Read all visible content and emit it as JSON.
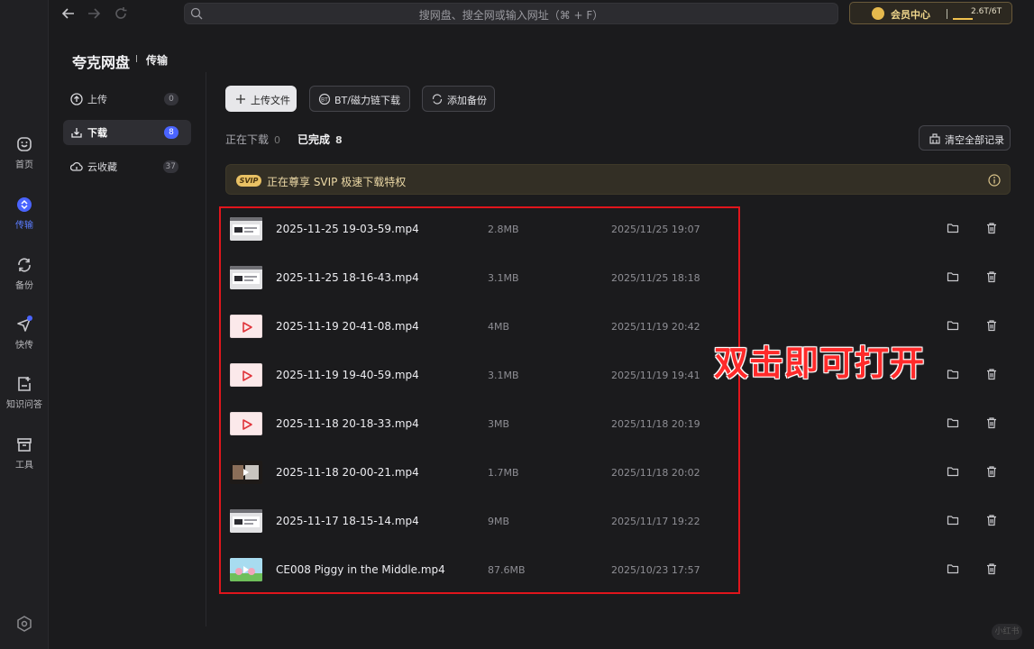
{
  "topbar": {
    "search_placeholder": "搜网盘、搜全网或输入网址（⌘ + F）",
    "vip_label": "会员中心",
    "storage_text": "2.6T/6T",
    "storage_used_fraction": 0.43
  },
  "rail": {
    "items": [
      {
        "label": "首页",
        "icon": "home-icon"
      },
      {
        "label": "传输",
        "icon": "transfer-icon"
      },
      {
        "label": "备份",
        "icon": "backup-icon"
      },
      {
        "label": "快传",
        "icon": "send-icon"
      },
      {
        "label": "知识问答",
        "icon": "qa-icon"
      },
      {
        "label": "工具",
        "icon": "toolbox-icon"
      }
    ]
  },
  "header": {
    "app_name": "夸克网盘",
    "section": "传输"
  },
  "sidebar": {
    "items": [
      {
        "label": "上传",
        "count": "0"
      },
      {
        "label": "下载",
        "count": "8"
      },
      {
        "label": "云收藏",
        "count": "37"
      }
    ]
  },
  "toolbar": {
    "upload_label": "上传文件",
    "bt_label": "BT/磁力链下载",
    "backup_label": "添加备份",
    "clear_label": "清空全部记录"
  },
  "tabs": [
    {
      "label": "正在下载",
      "count": "0"
    },
    {
      "label": "已完成",
      "count": "8"
    }
  ],
  "banner": {
    "badge": "SVIP",
    "text": "正在尊享 SVIP 极速下载特权"
  },
  "files": [
    {
      "name": "2025-11-25 19-03-59.mp4",
      "size": "2.8MB",
      "date": "2025/11/25 19:07",
      "thumb": "screen"
    },
    {
      "name": "2025-11-25 18-16-43.mp4",
      "size": "3.1MB",
      "date": "2025/11/25 18:18",
      "thumb": "screen"
    },
    {
      "name": "2025-11-19 20-41-08.mp4",
      "size": "4MB",
      "date": "2025/11/19 20:42",
      "thumb": "play"
    },
    {
      "name": "2025-11-19 19-40-59.mp4",
      "size": "3.1MB",
      "date": "2025/11/19 19:41",
      "thumb": "play"
    },
    {
      "name": "2025-11-18 20-18-33.mp4",
      "size": "3MB",
      "date": "2025/11/18 20:19",
      "thumb": "play"
    },
    {
      "name": "2025-11-18 20-00-21.mp4",
      "size": "1.7MB",
      "date": "2025/11/18 20:02",
      "thumb": "dark"
    },
    {
      "name": "2025-11-17 18-15-14.mp4",
      "size": "9MB",
      "date": "2025/11/17 19:22",
      "thumb": "screen"
    },
    {
      "name": "CE008 Piggy in the Middle.mp4",
      "size": "87.6MB",
      "date": "2025/10/23 17:57",
      "thumb": "pig"
    }
  ],
  "annotation": {
    "text": "双击即可打开",
    "color": "#ff2a2a"
  },
  "watermark": "小红书",
  "colors": {
    "accent": "#4a64ff",
    "vip_gold": "#e9c164",
    "highlight": "#e0151c"
  }
}
